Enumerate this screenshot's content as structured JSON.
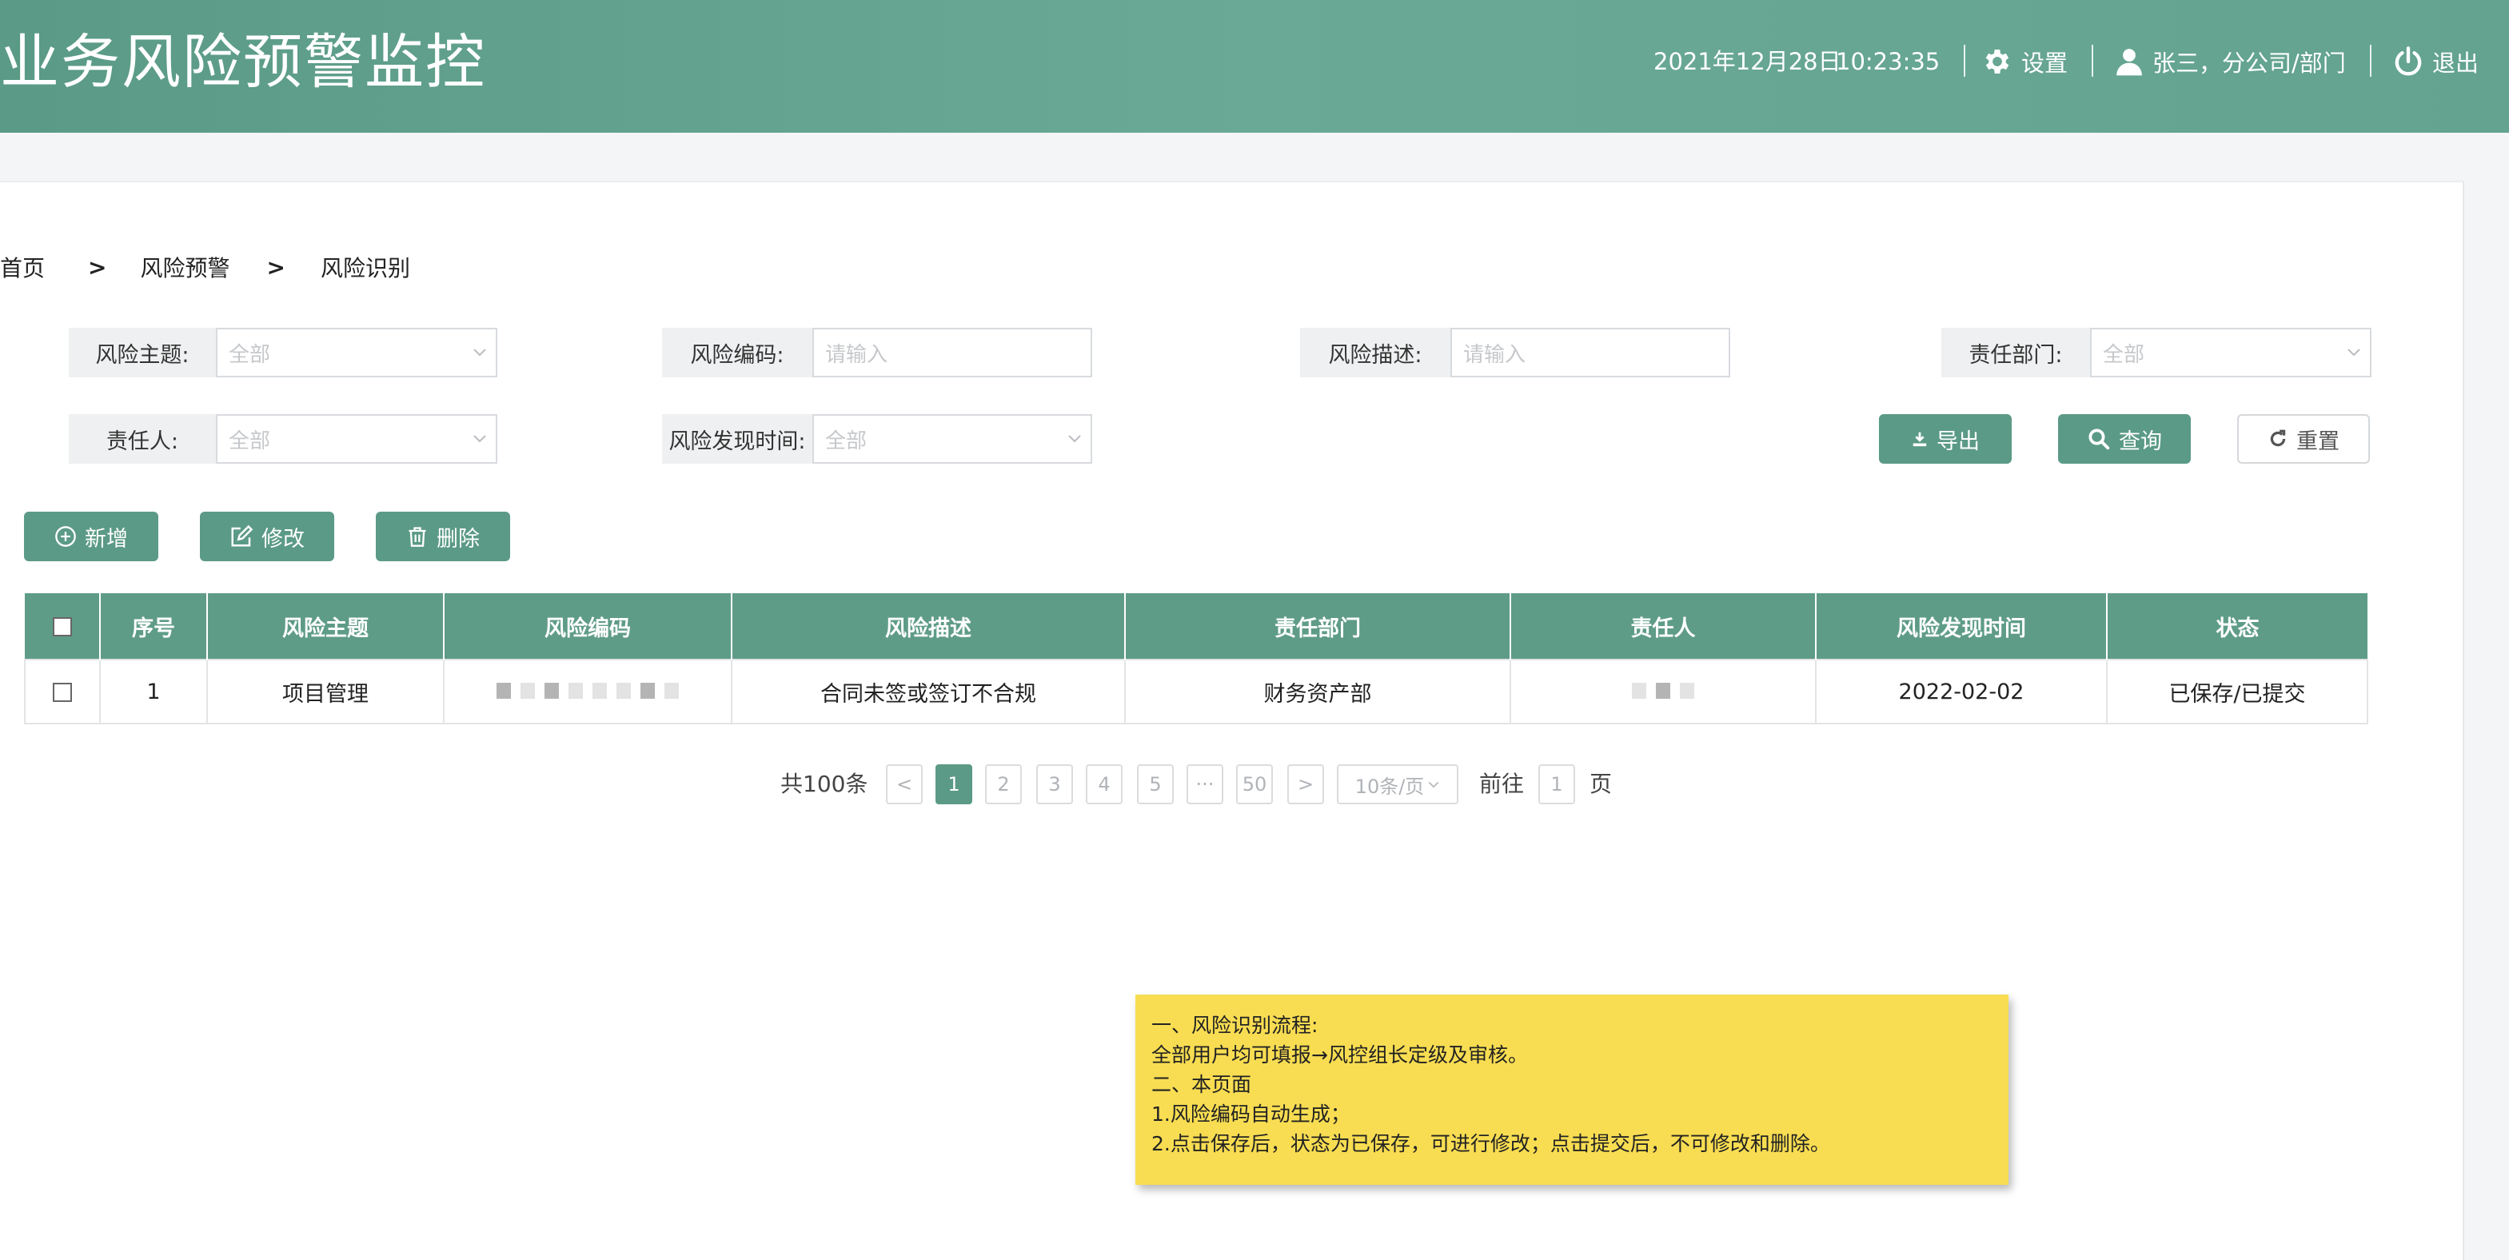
{
  "header": {
    "app_title": "业务风险预警监控",
    "date": "2021年12月28日",
    "time": "10:23:35",
    "settings_label": "设置",
    "user_label": "张三，分公司/部门",
    "logout_label": "退出"
  },
  "breadcrumb": {
    "home": "首页",
    "separator": ">",
    "level1": "风险预警",
    "level2": "风险识别"
  },
  "filters": {
    "risk_subject": {
      "label": "风险主题:",
      "value": "全部"
    },
    "risk_code": {
      "label": "风险编码:",
      "placeholder": "请输入"
    },
    "risk_desc": {
      "label": "风险描述:",
      "placeholder": "请输入"
    },
    "dept": {
      "label": "责任部门:",
      "value": "全部"
    },
    "owner": {
      "label": "责任人:",
      "value": "全部"
    },
    "found_time": {
      "label": "风险发现时间:",
      "value": "全部"
    }
  },
  "buttons": {
    "export": "导出",
    "query": "查询",
    "reset": "重置",
    "add": "新增",
    "edit": "修改",
    "delete": "删除"
  },
  "table": {
    "columns": [
      "序号",
      "风险主题",
      "风险编码",
      "风险描述",
      "责任部门",
      "责任人",
      "风险发现时间",
      "状态"
    ],
    "rows": [
      {
        "index": "1",
        "subject": "项目管理",
        "code": "",
        "desc": "合同未签或签订不合规",
        "dept": "财务资产部",
        "owner": "",
        "found_date": "2022-02-02",
        "status": "已保存/已提交"
      }
    ]
  },
  "pagination": {
    "total": "共100条",
    "prev": "<",
    "pages": [
      "1",
      "2",
      "3",
      "4",
      "5",
      "···",
      "50"
    ],
    "next": ">",
    "page_size": "10条/页",
    "goto_label": "前往",
    "goto_value": "1",
    "page_unit": "页"
  },
  "note": {
    "lines": [
      "一、风险识别流程:",
      "全部用户均可填报→风控组长定级及审核。",
      "二、本页面",
      "1.风险编码自动生成；",
      "2.点击保存后，状态为已保存，可进行修改；点击提交后，不可修改和删除。"
    ]
  },
  "colors": {
    "primary": "#5b9a86",
    "header_bg": "#63a38f",
    "note_bg": "#f8dd52"
  }
}
